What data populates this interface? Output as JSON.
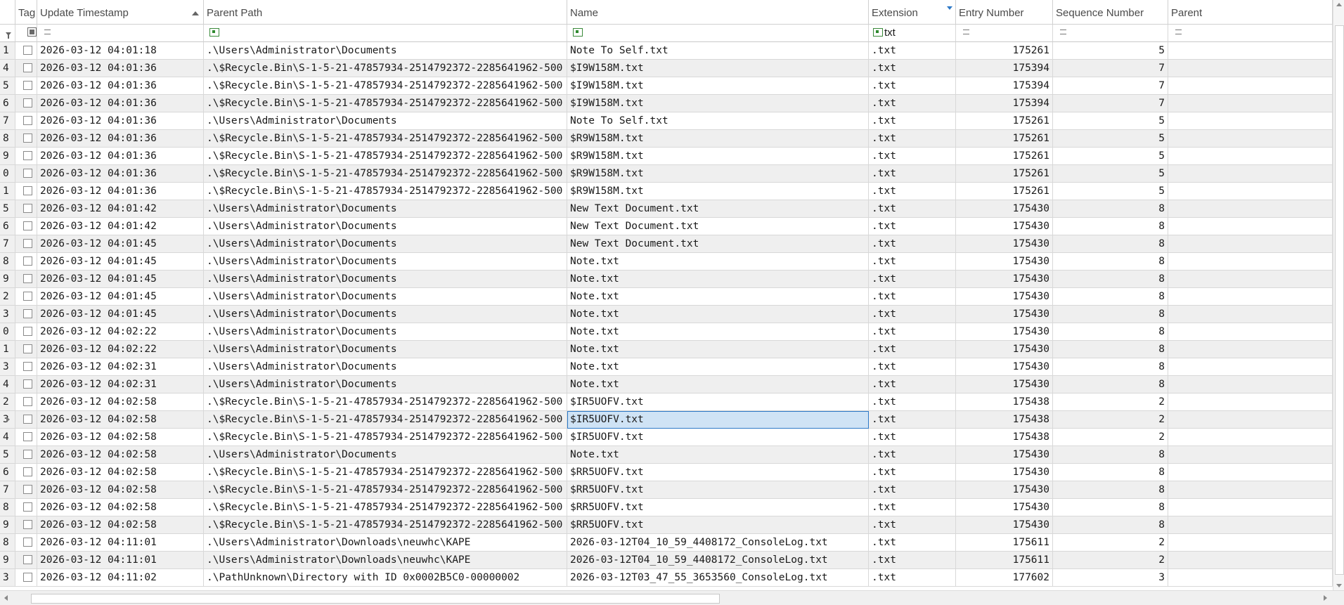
{
  "columns": {
    "tag": "Tag",
    "update_timestamp": "Update Timestamp",
    "parent_path": "Parent Path",
    "name": "Name",
    "extension": "Extension",
    "entry_number": "Entry Number",
    "sequence_number": "Sequence Number",
    "parent": "Parent"
  },
  "filters": {
    "extension_value": "txt"
  },
  "selected_row": 21,
  "rows": [
    {
      "n": "1",
      "ts": "2026-03-12 04:01:18",
      "path": ".\\Users\\Administrator\\Documents",
      "name": "Note To Self.txt",
      "ext": ".txt",
      "entry": "175261",
      "seq": "5"
    },
    {
      "n": "4",
      "ts": "2026-03-12 04:01:36",
      "path": ".\\$Recycle.Bin\\S-1-5-21-47857934-2514792372-2285641962-500",
      "name": "$I9W158M.txt",
      "ext": ".txt",
      "entry": "175394",
      "seq": "7"
    },
    {
      "n": "5",
      "ts": "2026-03-12 04:01:36",
      "path": ".\\$Recycle.Bin\\S-1-5-21-47857934-2514792372-2285641962-500",
      "name": "$I9W158M.txt",
      "ext": ".txt",
      "entry": "175394",
      "seq": "7"
    },
    {
      "n": "6",
      "ts": "2026-03-12 04:01:36",
      "path": ".\\$Recycle.Bin\\S-1-5-21-47857934-2514792372-2285641962-500",
      "name": "$I9W158M.txt",
      "ext": ".txt",
      "entry": "175394",
      "seq": "7"
    },
    {
      "n": "7",
      "ts": "2026-03-12 04:01:36",
      "path": ".\\Users\\Administrator\\Documents",
      "name": "Note To Self.txt",
      "ext": ".txt",
      "entry": "175261",
      "seq": "5"
    },
    {
      "n": "8",
      "ts": "2026-03-12 04:01:36",
      "path": ".\\$Recycle.Bin\\S-1-5-21-47857934-2514792372-2285641962-500",
      "name": "$R9W158M.txt",
      "ext": ".txt",
      "entry": "175261",
      "seq": "5"
    },
    {
      "n": "9",
      "ts": "2026-03-12 04:01:36",
      "path": ".\\$Recycle.Bin\\S-1-5-21-47857934-2514792372-2285641962-500",
      "name": "$R9W158M.txt",
      "ext": ".txt",
      "entry": "175261",
      "seq": "5"
    },
    {
      "n": "0",
      "ts": "2026-03-12 04:01:36",
      "path": ".\\$Recycle.Bin\\S-1-5-21-47857934-2514792372-2285641962-500",
      "name": "$R9W158M.txt",
      "ext": ".txt",
      "entry": "175261",
      "seq": "5"
    },
    {
      "n": "1",
      "ts": "2026-03-12 04:01:36",
      "path": ".\\$Recycle.Bin\\S-1-5-21-47857934-2514792372-2285641962-500",
      "name": "$R9W158M.txt",
      "ext": ".txt",
      "entry": "175261",
      "seq": "5"
    },
    {
      "n": "5",
      "ts": "2026-03-12 04:01:42",
      "path": ".\\Users\\Administrator\\Documents",
      "name": "New Text Document.txt",
      "ext": ".txt",
      "entry": "175430",
      "seq": "8"
    },
    {
      "n": "6",
      "ts": "2026-03-12 04:01:42",
      "path": ".\\Users\\Administrator\\Documents",
      "name": "New Text Document.txt",
      "ext": ".txt",
      "entry": "175430",
      "seq": "8"
    },
    {
      "n": "7",
      "ts": "2026-03-12 04:01:45",
      "path": ".\\Users\\Administrator\\Documents",
      "name": "New Text Document.txt",
      "ext": ".txt",
      "entry": "175430",
      "seq": "8"
    },
    {
      "n": "8",
      "ts": "2026-03-12 04:01:45",
      "path": ".\\Users\\Administrator\\Documents",
      "name": "Note.txt",
      "ext": ".txt",
      "entry": "175430",
      "seq": "8"
    },
    {
      "n": "9",
      "ts": "2026-03-12 04:01:45",
      "path": ".\\Users\\Administrator\\Documents",
      "name": "Note.txt",
      "ext": ".txt",
      "entry": "175430",
      "seq": "8"
    },
    {
      "n": "2",
      "ts": "2026-03-12 04:01:45",
      "path": ".\\Users\\Administrator\\Documents",
      "name": "Note.txt",
      "ext": ".txt",
      "entry": "175430",
      "seq": "8"
    },
    {
      "n": "3",
      "ts": "2026-03-12 04:01:45",
      "path": ".\\Users\\Administrator\\Documents",
      "name": "Note.txt",
      "ext": ".txt",
      "entry": "175430",
      "seq": "8"
    },
    {
      "n": "0",
      "ts": "2026-03-12 04:02:22",
      "path": ".\\Users\\Administrator\\Documents",
      "name": "Note.txt",
      "ext": ".txt",
      "entry": "175430",
      "seq": "8"
    },
    {
      "n": "1",
      "ts": "2026-03-12 04:02:22",
      "path": ".\\Users\\Administrator\\Documents",
      "name": "Note.txt",
      "ext": ".txt",
      "entry": "175430",
      "seq": "8"
    },
    {
      "n": "3",
      "ts": "2026-03-12 04:02:31",
      "path": ".\\Users\\Administrator\\Documents",
      "name": "Note.txt",
      "ext": ".txt",
      "entry": "175430",
      "seq": "8"
    },
    {
      "n": "4",
      "ts": "2026-03-12 04:02:31",
      "path": ".\\Users\\Administrator\\Documents",
      "name": "Note.txt",
      "ext": ".txt",
      "entry": "175430",
      "seq": "8"
    },
    {
      "n": "2",
      "ts": "2026-03-12 04:02:58",
      "path": ".\\$Recycle.Bin\\S-1-5-21-47857934-2514792372-2285641962-500",
      "name": "$IR5UOFV.txt",
      "ext": ".txt",
      "entry": "175438",
      "seq": "2"
    },
    {
      "n": "3",
      "ts": "2026-03-12 04:02:58",
      "path": ".\\$Recycle.Bin\\S-1-5-21-47857934-2514792372-2285641962-500",
      "name": "$IR5UOFV.txt",
      "ext": ".txt",
      "entry": "175438",
      "seq": "2"
    },
    {
      "n": "4",
      "ts": "2026-03-12 04:02:58",
      "path": ".\\$Recycle.Bin\\S-1-5-21-47857934-2514792372-2285641962-500",
      "name": "$IR5UOFV.txt",
      "ext": ".txt",
      "entry": "175438",
      "seq": "2"
    },
    {
      "n": "5",
      "ts": "2026-03-12 04:02:58",
      "path": ".\\Users\\Administrator\\Documents",
      "name": "Note.txt",
      "ext": ".txt",
      "entry": "175430",
      "seq": "8"
    },
    {
      "n": "6",
      "ts": "2026-03-12 04:02:58",
      "path": ".\\$Recycle.Bin\\S-1-5-21-47857934-2514792372-2285641962-500",
      "name": "$RR5UOFV.txt",
      "ext": ".txt",
      "entry": "175430",
      "seq": "8"
    },
    {
      "n": "7",
      "ts": "2026-03-12 04:02:58",
      "path": ".\\$Recycle.Bin\\S-1-5-21-47857934-2514792372-2285641962-500",
      "name": "$RR5UOFV.txt",
      "ext": ".txt",
      "entry": "175430",
      "seq": "8"
    },
    {
      "n": "8",
      "ts": "2026-03-12 04:02:58",
      "path": ".\\$Recycle.Bin\\S-1-5-21-47857934-2514792372-2285641962-500",
      "name": "$RR5UOFV.txt",
      "ext": ".txt",
      "entry": "175430",
      "seq": "8"
    },
    {
      "n": "9",
      "ts": "2026-03-12 04:02:58",
      "path": ".\\$Recycle.Bin\\S-1-5-21-47857934-2514792372-2285641962-500",
      "name": "$RR5UOFV.txt",
      "ext": ".txt",
      "entry": "175430",
      "seq": "8"
    },
    {
      "n": "8",
      "ts": "2026-03-12 04:11:01",
      "path": ".\\Users\\Administrator\\Downloads\\neuwhc\\KAPE",
      "name": "2026-03-12T04_10_59_4408172_ConsoleLog.txt",
      "ext": ".txt",
      "entry": "175611",
      "seq": "2"
    },
    {
      "n": "9",
      "ts": "2026-03-12 04:11:01",
      "path": ".\\Users\\Administrator\\Downloads\\neuwhc\\KAPE",
      "name": "2026-03-12T04_10_59_4408172_ConsoleLog.txt",
      "ext": ".txt",
      "entry": "175611",
      "seq": "2"
    },
    {
      "n": "3",
      "ts": "2026-03-12 04:11:02",
      "path": ".\\PathUnknown\\Directory with ID 0x0002B5C0-00000002",
      "name": "2026-03-12T03_47_55_3653560_ConsoleLog.txt",
      "ext": ".txt",
      "entry": "177602",
      "seq": "3"
    }
  ]
}
